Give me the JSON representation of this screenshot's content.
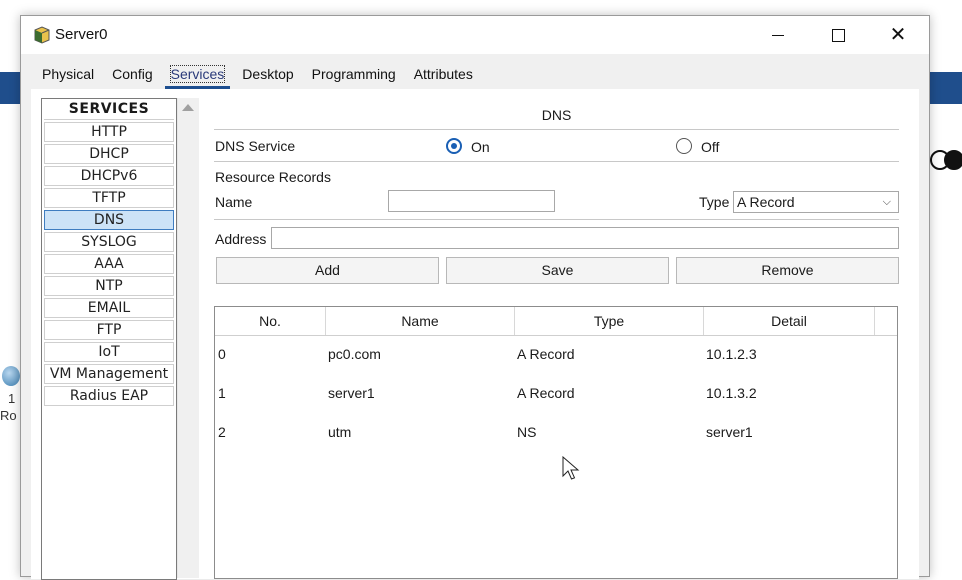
{
  "background": {
    "router_label_top": "1",
    "router_label_bottom": "Ro"
  },
  "window": {
    "title": "Server0",
    "icon": "server-icon"
  },
  "tabs": [
    {
      "label": "Physical"
    },
    {
      "label": "Config"
    },
    {
      "label": "Services",
      "active": true
    },
    {
      "label": "Desktop"
    },
    {
      "label": "Programming"
    },
    {
      "label": "Attributes"
    }
  ],
  "services": {
    "header": "SERVICES",
    "items": [
      "HTTP",
      "DHCP",
      "DHCPv6",
      "TFTP",
      "DNS",
      "SYSLOG",
      "AAA",
      "NTP",
      "EMAIL",
      "FTP",
      "IoT",
      "VM Management",
      "Radius EAP"
    ],
    "selected": "DNS"
  },
  "dns": {
    "title": "DNS",
    "service_label": "DNS Service",
    "on_label": "On",
    "off_label": "Off",
    "service_state": "On",
    "resource_records_label": "Resource Records",
    "name_label": "Name",
    "name_value": "",
    "type_label": "Type",
    "type_value": "A Record",
    "address_label": "Address",
    "address_value": "",
    "buttons": {
      "add": "Add",
      "save": "Save",
      "remove": "Remove"
    },
    "table": {
      "columns": [
        "No.",
        "Name",
        "Type",
        "Detail"
      ],
      "rows": [
        {
          "no": "0",
          "name": "pc0.com",
          "type": "A Record",
          "detail": "10.1.2.3"
        },
        {
          "no": "1",
          "name": "server1",
          "type": "A Record",
          "detail": "10.1.3.2"
        },
        {
          "no": "2",
          "name": "utm",
          "type": "NS",
          "detail": "server1"
        }
      ]
    }
  },
  "colors": {
    "accent": "#1a5fb4",
    "selected_bg": "#cde3f7",
    "tab_underline": "#1d4e8f"
  }
}
